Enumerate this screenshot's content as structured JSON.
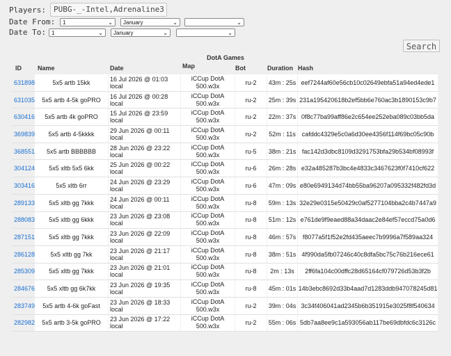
{
  "filters": {
    "players_label": "Players:",
    "players_value": "PUBG-_-Intel,Adrenaline3",
    "date_from_label": "Date From:",
    "date_to_label": "Date To:",
    "from_day": "1",
    "from_month": "January",
    "from_year": "",
    "to_day": "1",
    "to_month": "January",
    "to_year": ""
  },
  "search_label": "Search",
  "table": {
    "caption": "DotA Games",
    "headers": {
      "id": "ID",
      "name": "Name",
      "date": "Date",
      "map": "Map",
      "bot": "Bot",
      "duration": "Duration",
      "hash": "Hash"
    },
    "rows": [
      {
        "id": "631898",
        "name": "5x5 artb 15kk",
        "date": "16 Jul 2026 @ 01:03 local",
        "map": "iCCup DotA 500.w3x",
        "bot": "ru-2",
        "duration": "43m : 25s",
        "hash": "eef7244af60e56cb10c02649ebfa51a94ed4ede1"
      },
      {
        "id": "631035",
        "name": "5x5 artb 4-5k goPRO",
        "date": "16 Jul 2026 @ 00:28 local",
        "map": "iCCup DotA 500.w3x",
        "bot": "ru-2",
        "duration": "25m : 39s",
        "hash": "231a195420618b2ef5bb6e760ac3b1890153c9b7"
      },
      {
        "id": "630416",
        "name": "5x5 artb 4k goPRO",
        "date": "15 Jul 2026 @ 23:59 local",
        "map": "iCCup DotA 500.w3x",
        "bot": "ru-2",
        "duration": "22m : 37s",
        "hash": "0f8c77ba99aff86e2c654ee252eba089c03bb5da"
      },
      {
        "id": "369839",
        "name": "5x5 artb 4-5kkkk",
        "date": "29 Jun 2026 @ 00:11 local",
        "map": "iCCup DotA 500.w3x",
        "bot": "ru-2",
        "duration": "52m : 11s",
        "hash": "cafddc4329e5c0a6d30ee4356f114f69bc05c90b"
      },
      {
        "id": "368551",
        "name": "5x5 artb BBBBBB",
        "date": "28 Jun 2026 @ 23:22 local",
        "map": "iCCup DotA 500.w3x",
        "bot": "ru-5",
        "duration": "38m : 21s",
        "hash": "fac142d3dbc8109d3291753bfa29b534bf08993f"
      },
      {
        "id": "304124",
        "name": "5x5 xltb 5x5 6kk",
        "date": "25 Jun 2026 @ 00:22 local",
        "map": "iCCup DotA 500.w3x",
        "bot": "ru-6",
        "duration": "26m : 28s",
        "hash": "e32a485287b3bc4e4833c3467623f0f7410cf622"
      },
      {
        "id": "303416",
        "name": "5x5 xltb 6rr",
        "date": "24 Jun 2026 @ 23:29 local",
        "map": "iCCup DotA 500.w3x",
        "bot": "ru-6",
        "duration": "47m : 09s",
        "hash": "e80e6949134d74bb55ba96207a095332f482fd3d"
      },
      {
        "id": "289133",
        "name": "5x5 xltb gg 7kkk",
        "date": "24 Jun 2026 @ 00:11 local",
        "map": "iCCup DotA 500.w3x",
        "bot": "ru-8",
        "duration": "59m : 13s",
        "hash": "32e29e0315e50429c0af5277104bba2c4b7447a9"
      },
      {
        "id": "288083",
        "name": "5x5 xltb gg 6kkk",
        "date": "23 Jun 2026 @ 23:08 local",
        "map": "iCCup DotA 500.w3x",
        "bot": "ru-8",
        "duration": "51m : 12s",
        "hash": "e761de9f9eaed88a34daac2e84ef57eccd75a0d6"
      },
      {
        "id": "287151",
        "name": "5x5 xltb gg 7kkk",
        "date": "23 Jun 2026 @ 22:09 local",
        "map": "iCCup DotA 500.w3x",
        "bot": "ru-8",
        "duration": "46m : 57s",
        "hash": "f8077a5f1f52e2fd435aeec7b9996a7f589aa324"
      },
      {
        "id": "286128",
        "name": "5x5 xltb gg 7kk",
        "date": "23 Jun 2026 @ 21:17 local",
        "map": "iCCup DotA 500.w3x",
        "bot": "ru-8",
        "duration": "38m : 51s",
        "hash": "4f990da5fb07246c40c8dfa5bc75c76b216ece61"
      },
      {
        "id": "285309",
        "name": "5x5 xltb gg 7kkk",
        "date": "23 Jun 2026 @ 21:01 local",
        "map": "iCCup DotA 500.w3x",
        "bot": "ru-8",
        "duration": "2m : 13s",
        "hash": "2ff6fa104c00dffc28d65164cf079726d53b3f2b"
      },
      {
        "id": "284676",
        "name": "5x5 xltb gg 6k7kk",
        "date": "23 Jun 2026 @ 19:35 local",
        "map": "iCCup DotA 500.w3x",
        "bot": "ru-8",
        "duration": "45m : 01s",
        "hash": "14b3ebc8692d33b4aad7d1283ddb947078245d81"
      },
      {
        "id": "283749",
        "name": "5x5 artb 4-6k goFast",
        "date": "23 Jun 2026 @ 18:33 local",
        "map": "iCCup DotA 500.w3x",
        "bot": "ru-2",
        "duration": "39m : 04s",
        "hash": "3c34f406041ad2345b6b351915e3025f8f540634"
      },
      {
        "id": "282982",
        "name": "5x5 artb 3-5k goPRO",
        "date": "23 Jun 2026 @ 17:22 local",
        "map": "iCCup DotA 500.w3x",
        "bot": "ru-2",
        "duration": "55m : 06s",
        "hash": "5db7aa8ee9c1a593056ab117be69dbfdc6c3126c"
      }
    ]
  }
}
